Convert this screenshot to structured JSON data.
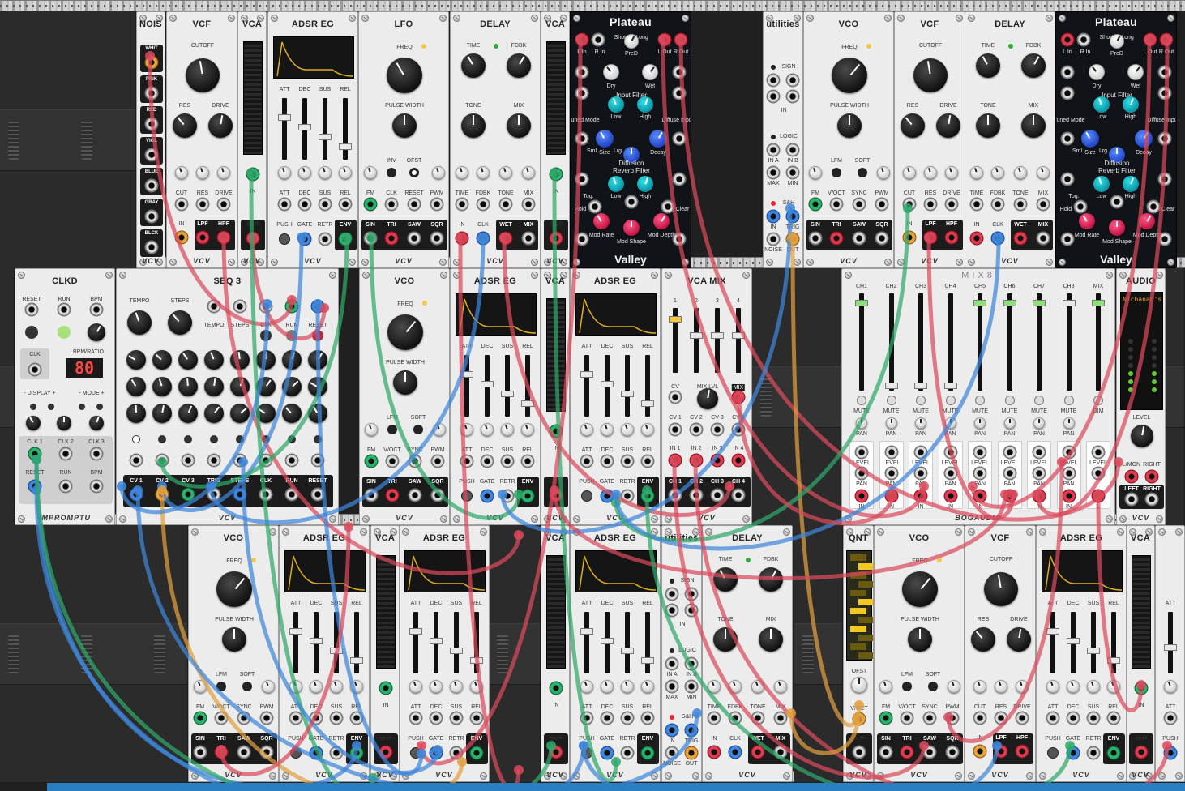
{
  "rows": [
    {
      "modules": [
        {
          "key": "nois",
          "title": "NOIS",
          "footer": "VCV",
          "labels": [
            "WHIT",
            "PINK",
            "RED",
            "VIOL",
            "BLUE",
            "GRAY",
            "BLCK"
          ]
        },
        {
          "key": "vcf1",
          "title": "VCF",
          "footer": "VCV",
          "labels": [
            "CUTOFF",
            "RES",
            "DRIVE",
            "CUT",
            "RES",
            "DRIVE",
            "IN",
            "LPF",
            "HPF"
          ]
        },
        {
          "key": "vca1",
          "title": "VCA",
          "footer": "VCV",
          "labels": [
            "IN",
            "OUT"
          ]
        },
        {
          "key": "adsr1",
          "title": "ADSR EG",
          "footer": "VCV",
          "labels": [
            "ATT",
            "DEC",
            "SUS",
            "REL",
            "ATT",
            "DEC",
            "SUS",
            "REL",
            "PUSH",
            "GATE",
            "RETR",
            "ENV"
          ]
        },
        {
          "key": "lfo1",
          "title": "LFO",
          "footer": "VCV",
          "labels": [
            "FREQ",
            "PULSE WIDTH",
            "INV",
            "OFST",
            "FM",
            "CLK",
            "RESET",
            "PWM",
            "SIN",
            "TRI",
            "SAW",
            "SQR"
          ]
        },
        {
          "key": "delay1",
          "title": "DELAY",
          "footer": "VCV",
          "labels": [
            "TIME",
            "FDBK",
            "TONE",
            "MIX",
            "TIME",
            "FDBK",
            "TONE",
            "MIX",
            "IN",
            "CLK",
            "WET",
            "MIX"
          ]
        },
        {
          "key": "vca2",
          "title": "VCA",
          "footer": "VCV",
          "labels": [
            "IN",
            "OUT"
          ]
        },
        {
          "key": "plateau1",
          "title": "Plateau",
          "footer": "Valley",
          "labels": [
            "L In",
            "R In",
            "PreD",
            "Short",
            "Long",
            "L Out",
            "R Out",
            "Dry",
            "Wet",
            "Input Filter",
            "Low",
            "High",
            "Tuned Mode",
            "Diffuse Input",
            "Size",
            "Decay",
            "Sml",
            "Lrg",
            "Diffusion",
            "Reverb Filter",
            "Tog.",
            "Low",
            "High",
            "Hold",
            "Clear",
            "Mod Rate",
            "Mod Shape",
            "Mod Depth",
            "Slow",
            "Fast"
          ]
        },
        {
          "key": "util1",
          "title": "utilities",
          "footer": "",
          "labels": [
            "SIGN",
            "IN",
            "LOGIC",
            "IN A",
            "IN B",
            "MAX",
            "MIN",
            "S&H",
            "IN",
            "TRIG",
            "NOISE",
            "OUT"
          ]
        },
        {
          "key": "vco1",
          "title": "VCO",
          "footer": "VCV",
          "labels": [
            "FREQ",
            "PULSE WIDTH",
            "LFM",
            "SOFT",
            "FM",
            "V/OCT",
            "SYNC",
            "PWM",
            "SIN",
            "TRI",
            "SAW",
            "SQR"
          ]
        },
        {
          "key": "vcf2",
          "title": "VCF",
          "footer": "VCV",
          "labels": [
            "CUTOFF",
            "RES",
            "DRIVE",
            "CUT",
            "RES",
            "DRIVE",
            "IN",
            "LPF",
            "HPF"
          ]
        },
        {
          "key": "delay2",
          "title": "DELAY",
          "footer": "VCV",
          "labels": [
            "TIME",
            "FDBK",
            "TONE",
            "MIX",
            "TIME",
            "FDBK",
            "TONE",
            "MIX",
            "IN",
            "CLK",
            "WET",
            "MIX"
          ]
        },
        {
          "key": "plateau2",
          "title": "Plateau",
          "footer": "Valley",
          "labels": [
            "L In",
            "R In",
            "PreD",
            "Short",
            "Long",
            "L Out",
            "R Out",
            "Dry",
            "Wet",
            "Input Filter",
            "Low",
            "High",
            "Tuned Mode",
            "Diffuse Input",
            "Size",
            "Decay",
            "Sml",
            "Lrg",
            "Diffusion",
            "Reverb Filter",
            "Tog.",
            "Low",
            "High",
            "Hold",
            "Clear",
            "Mod Rate",
            "Mod Shape",
            "Mod Depth",
            "Slow",
            "Fast"
          ]
        }
      ]
    },
    {
      "modules": [
        {
          "key": "clkd",
          "title": "CLKD",
          "footer": "IMPROMPTU",
          "labels": [
            "RESET",
            "RUN",
            "BPM",
            "CLK",
            "BPM/RATIO",
            "- DISPLAY +",
            "- MODE +",
            "CLK 1",
            "CLK 2",
            "CLK 3",
            "RESET",
            "RUN",
            "BPM"
          ],
          "display": "80"
        },
        {
          "key": "seq3",
          "title": "SEQ 3",
          "footer": "VCV",
          "labels": [
            "TEMPO",
            "STEPS",
            "TEMPO",
            "STEPS",
            "CLK",
            "RUN",
            "RESET",
            "CV 1",
            "CV 2",
            "CV 3",
            "TRIG",
            "STEPS",
            "CLK",
            "RUN",
            "RESET"
          ]
        },
        {
          "key": "vco2",
          "title": "VCO",
          "footer": "VCV",
          "labels": [
            "FREQ",
            "PULSE WIDTH",
            "LFM",
            "SOFT",
            "FM",
            "V/OCT",
            "SYNC",
            "PWM",
            "SIN",
            "TRI",
            "SAW",
            "SQR"
          ]
        },
        {
          "key": "adsr2",
          "title": "ADSR EG",
          "footer": "VCV",
          "labels": [
            "ATT",
            "DEC",
            "SUS",
            "REL",
            "ATT",
            "DEC",
            "SUS",
            "REL",
            "PUSH",
            "GATE",
            "RETR",
            "ENV"
          ]
        },
        {
          "key": "vca3",
          "title": "VCA",
          "footer": "VCV",
          "labels": [
            "IN",
            "OUT"
          ]
        },
        {
          "key": "adsr3",
          "title": "ADSR EG",
          "footer": "VCV",
          "labels": [
            "ATT",
            "DEC",
            "SUS",
            "REL",
            "ATT",
            "DEC",
            "SUS",
            "REL",
            "PUSH",
            "GATE",
            "RETR",
            "ENV"
          ]
        },
        {
          "key": "vcamix",
          "title": "VCA MIX",
          "footer": "VCV",
          "labels": [
            "1",
            "2",
            "3",
            "4",
            "CV",
            "MIX LVL",
            "MIX",
            "CV 1",
            "CV 2",
            "CV 3",
            "CV 4",
            "IN 1",
            "IN 2",
            "IN 3",
            "IN 4",
            "CH 1",
            "CH 2",
            "CH 3",
            "CH 4"
          ]
        },
        {
          "key": "mix8",
          "title": "MIX8",
          "footer": "BOGAUDIO",
          "labels": [
            "CH1",
            "CH2",
            "CH3",
            "CH4",
            "CH5",
            "CH6",
            "CH7",
            "CH8",
            "MIX",
            "MUTE",
            "PAN",
            "LEVEL",
            "IN",
            "DIM",
            "L",
            "R"
          ]
        },
        {
          "key": "audio",
          "title": "AUDIO",
          "footer": "VCV",
          "labels": [
            "LEVEL",
            "L/MON",
            "RIGHT",
            "LEFT",
            "RIGHT"
          ],
          "device": "Nichanan's"
        }
      ]
    },
    {
      "modules": [
        {
          "key": "vco3",
          "title": "VCO",
          "footer": "VCV",
          "labels": [
            "FREQ",
            "PULSE WIDTH",
            "LFM",
            "SOFT",
            "FM",
            "V/OCT",
            "SYNC",
            "PWM",
            "SIN",
            "TRI",
            "SAW",
            "SQR"
          ]
        },
        {
          "key": "adsr4",
          "title": "ADSR EG",
          "footer": "VCV",
          "labels": [
            "ATT",
            "DEC",
            "SUS",
            "REL",
            "ATT",
            "DEC",
            "SUS",
            "REL",
            "PUSH",
            "GATE",
            "RETR",
            "ENV"
          ]
        },
        {
          "key": "vca4",
          "title": "VCA",
          "footer": "VCV",
          "labels": [
            "IN",
            "OUT"
          ]
        },
        {
          "key": "adsr5",
          "title": "ADSR EG",
          "footer": "VCV",
          "labels": [
            "ATT",
            "DEC",
            "SUS",
            "REL",
            "ATT",
            "DEC",
            "SUS",
            "REL",
            "PUSH",
            "GATE",
            "RETR",
            "ENV"
          ]
        },
        {
          "key": "vca5",
          "title": "VCA",
          "footer": "VCV",
          "labels": [
            "IN",
            "OUT"
          ]
        },
        {
          "key": "adsr6",
          "title": "ADSR EG",
          "footer": "VCV",
          "labels": [
            "ATT",
            "DEC",
            "SUS",
            "REL",
            "ATT",
            "DEC",
            "SUS",
            "REL",
            "PUSH",
            "GATE",
            "RETR",
            "ENV"
          ]
        },
        {
          "key": "util2",
          "title": "utilities",
          "footer": "",
          "labels": [
            "SIGN",
            "IN",
            "LOGIC",
            "IN A",
            "IN B",
            "MAX",
            "MIN",
            "S&H",
            "IN",
            "TRIG",
            "NOISE",
            "OUT"
          ]
        },
        {
          "key": "delay3",
          "title": "DELAY",
          "footer": "VCV",
          "labels": [
            "TIME",
            "FDBK",
            "TONE",
            "MIX",
            "TIME",
            "FDBK",
            "TONE",
            "MIX",
            "IN",
            "CLK",
            "WET",
            "MIX"
          ]
        },
        {
          "key": "qnt",
          "title": "QNT",
          "footer": "VCV",
          "labels": [
            "OFST",
            "V/OCT",
            "OUT"
          ]
        },
        {
          "key": "vco4",
          "title": "VCO",
          "footer": "VCV",
          "labels": [
            "FREQ",
            "PULSE WIDTH",
            "LFM",
            "SOFT",
            "FM",
            "V/OCT",
            "SYNC",
            "PWM",
            "SIN",
            "TRI",
            "SAW",
            "SQR"
          ]
        },
        {
          "key": "vcf3",
          "title": "VCF",
          "footer": "VCV",
          "labels": [
            "CUTOFF",
            "RES",
            "DRIVE",
            "CUT",
            "RES",
            "DRIVE",
            "IN",
            "LPF",
            "HPF"
          ]
        },
        {
          "key": "adsr7",
          "title": "ADSR EG",
          "footer": "VCV",
          "labels": [
            "ATT",
            "DEC",
            "SUS",
            "REL",
            "ATT",
            "DEC",
            "SUS",
            "REL",
            "PUSH",
            "GATE",
            "RETR",
            "ENV"
          ]
        },
        {
          "key": "vca6",
          "title": "VCA",
          "footer": "VCV",
          "labels": [
            "IN",
            "OUT"
          ]
        },
        {
          "key": "adsr8",
          "title": "",
          "footer": "",
          "labels": [
            "ATT",
            "ATT",
            "PUSH"
          ]
        }
      ]
    }
  ],
  "colors": {
    "cable_red": "#d94a5c",
    "cable_blue": "#3f86d9",
    "cable_green": "#2ea86a",
    "cable_orange": "#e0a040",
    "panel": "#ececec",
    "rack_bg": "#202020",
    "menubar": "#2a7fc2"
  }
}
